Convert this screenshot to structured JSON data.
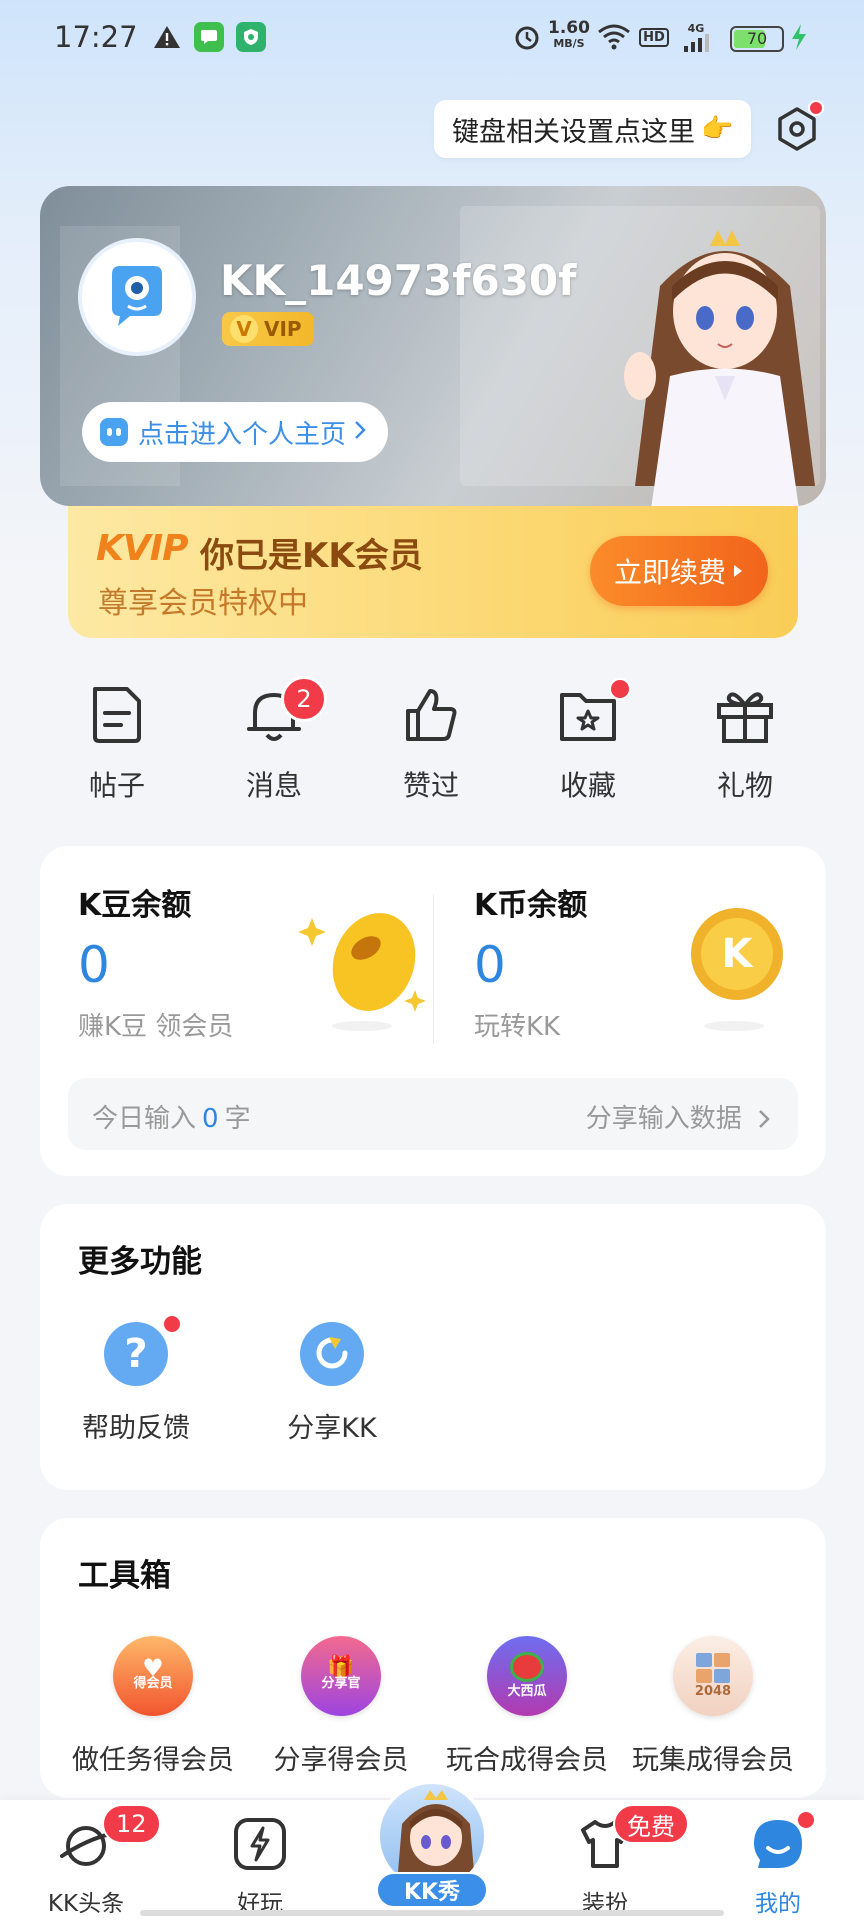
{
  "status_bar": {
    "time": "17:27",
    "net_speed_value": "1.60",
    "net_speed_unit": "MB/S",
    "hd": "HD",
    "signal": "4G",
    "battery": "70",
    "battery_level": 0.7
  },
  "keyboard_tip": {
    "text": "键盘相关设置点这里",
    "hand": "👉"
  },
  "profile": {
    "username": "KK_14973f630f",
    "vip_letter": "V",
    "vip_label": "VIP",
    "homepage_link": "点击进入个人主页"
  },
  "vip_banner": {
    "logo": "KVIP",
    "title": "你已是KK会员",
    "subtitle": "尊享会员特权中",
    "renew_button": "立即续费"
  },
  "quick_actions": [
    {
      "label": "帖子",
      "icon": "document-icon"
    },
    {
      "label": "消息",
      "icon": "bell-icon",
      "badge": "2"
    },
    {
      "label": "赞过",
      "icon": "thumbs-up-icon"
    },
    {
      "label": "收藏",
      "icon": "folder-star-icon",
      "dot": true
    },
    {
      "label": "礼物",
      "icon": "gift-icon"
    }
  ],
  "balance": {
    "beans": {
      "title": "K豆余额",
      "value": "0",
      "subtitle": "赚K豆 领会员"
    },
    "coins": {
      "title": "K币余额",
      "value": "0",
      "subtitle": "玩转KK",
      "coin_letter": "K"
    },
    "input_today_prefix": "今日输入",
    "input_today_count": "0",
    "input_today_suffix": "字",
    "share_input": "分享输入数据"
  },
  "more_functions": {
    "title": "更多功能",
    "items": [
      {
        "label": "帮助反馈",
        "icon": "help-icon",
        "glyph": "?"
      },
      {
        "label": "分享KK",
        "icon": "share-icon"
      }
    ]
  },
  "toolbox": {
    "title": "工具箱",
    "items": [
      {
        "label": "做任务得会员",
        "icon": "task-heart-icon",
        "badge_text": "得会员",
        "color": "#f56a3e"
      },
      {
        "label": "分享得会员",
        "icon": "gift-box-icon",
        "badge_text": "分享官",
        "color": "#b54de0"
      },
      {
        "label": "玩合成得会员",
        "icon": "watermelon-icon",
        "badge_text": "大西瓜",
        "color": "#7a52d9"
      },
      {
        "label": "玩集成得会员",
        "icon": "2048-icon",
        "badge_text": "2048",
        "color": "#f3d9c9"
      }
    ]
  },
  "bottom_nav": {
    "items": [
      {
        "label": "KK头条",
        "icon": "planet-icon",
        "badge": "12"
      },
      {
        "label": "好玩",
        "icon": "lightning-icon"
      },
      {
        "label": "KK秀",
        "icon": "kk-show-avatar-icon"
      },
      {
        "label": "装扮",
        "icon": "tshirt-icon",
        "badge": "免费"
      },
      {
        "label": "我的",
        "icon": "profile-bubble-icon",
        "dot": true,
        "active": true
      }
    ]
  },
  "colors": {
    "accent_blue": "#2e86de",
    "badge_red": "#f23b48",
    "vip_orange": "#f1641b"
  }
}
